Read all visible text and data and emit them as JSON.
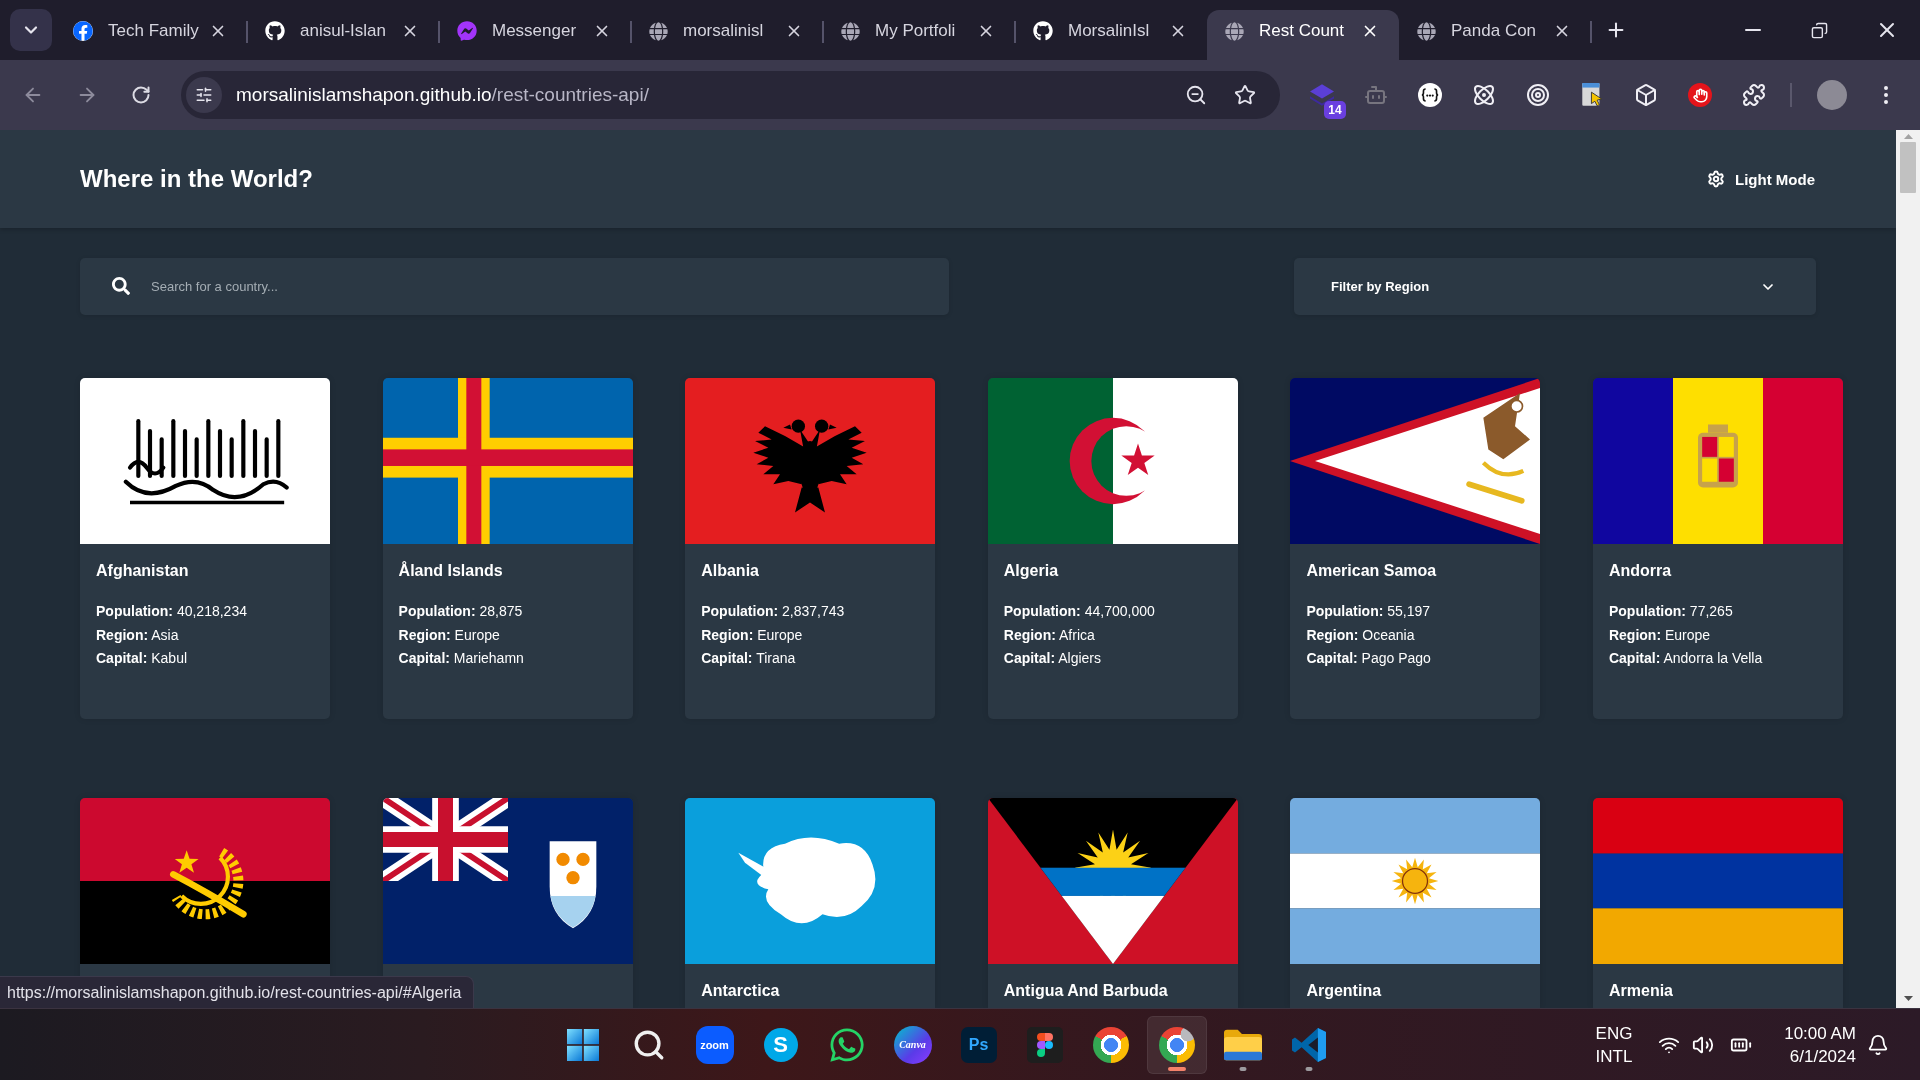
{
  "browser": {
    "tabs": [
      {
        "kind": "facebook",
        "title": "Tech Family",
        "selected": false
      },
      {
        "kind": "github",
        "title": "anisul-Islan",
        "selected": false
      },
      {
        "kind": "messenger",
        "title": "Messenger",
        "selected": false
      },
      {
        "kind": "globe",
        "title": "morsalinisl",
        "selected": false
      },
      {
        "kind": "globe",
        "title": "My Portfoli",
        "selected": false
      },
      {
        "kind": "github",
        "title": "MorsalinIsl",
        "selected": false
      },
      {
        "kind": "globe",
        "title": "Rest Count",
        "selected": true
      },
      {
        "kind": "globe",
        "title": "Panda Con",
        "selected": false
      }
    ],
    "nav": [
      {
        "kind": "back",
        "disabled": true
      },
      {
        "kind": "forward",
        "disabled": true
      },
      {
        "kind": "reload",
        "disabled": false
      }
    ],
    "address": {
      "host": "morsalinislamshapon.github.io",
      "path": "/rest-countries-api/"
    },
    "extensions": [
      {
        "kind": "layers",
        "badge": "14"
      },
      {
        "kind": "robot"
      },
      {
        "kind": "braces"
      },
      {
        "kind": "atom"
      },
      {
        "kind": "target"
      },
      {
        "kind": "pointer"
      },
      {
        "kind": "cube"
      },
      {
        "kind": "hand"
      },
      {
        "kind": "puzzle"
      }
    ],
    "status_url": "https://morsalinislamshapon.github.io/rest-countries-api/#Algeria"
  },
  "page": {
    "title": "Where in the World?",
    "theme_toggle": "Light Mode",
    "search": {
      "placeholder": "Search for a country..."
    },
    "filter": {
      "label": "Filter by Region"
    },
    "countries": [
      {
        "kind": "af",
        "name": "Afghanistan",
        "facts": [
          "**Population:** 40,218,234",
          "**Region:** Asia",
          "**Capital:** Kabul"
        ]
      },
      {
        "kind": "ax",
        "name": "Åland Islands",
        "facts": [
          "**Population:** 28,875",
          "**Region:** Europe",
          "**Capital:** Mariehamn"
        ]
      },
      {
        "kind": "al",
        "name": "Albania",
        "facts": [
          "**Population:** 2,837,743",
          "**Region:** Europe",
          "**Capital:** Tirana"
        ]
      },
      {
        "kind": "dz",
        "name": "Algeria",
        "facts": [
          "**Population:** 44,700,000",
          "**Region:** Africa",
          "**Capital:** Algiers"
        ]
      },
      {
        "kind": "as",
        "name": "American Samoa",
        "facts": [
          "**Population:** 55,197",
          "**Region:** Oceania",
          "**Capital:** Pago Pago"
        ]
      },
      {
        "kind": "ad",
        "name": "Andorra",
        "facts": [
          "**Population:** 77,265",
          "**Region:** Europe",
          "**Capital:** Andorra la Vella"
        ]
      },
      {
        "kind": "ao"
      },
      {
        "kind": "ai"
      },
      {
        "kind": "aq",
        "name": "Antarctica"
      },
      {
        "kind": "ag",
        "name": "Antigua And Barbuda"
      },
      {
        "kind": "ar",
        "name": "Argentina"
      },
      {
        "kind": "am",
        "name": "Armenia"
      }
    ]
  },
  "taskbar": {
    "apps": [
      {
        "kind": "start",
        "selected": false,
        "running": false
      },
      {
        "kind": "search",
        "selected": false,
        "running": false
      },
      {
        "kind": "zoom",
        "text": "zoom",
        "selected": false,
        "running": false
      },
      {
        "kind": "skype",
        "text": "S",
        "selected": false,
        "running": false
      },
      {
        "kind": "whatsapp",
        "selected": false,
        "running": false
      },
      {
        "kind": "canva",
        "text": "Canva",
        "selected": false,
        "running": false
      },
      {
        "kind": "photoshop",
        "text": "Ps",
        "selected": false,
        "running": false
      },
      {
        "kind": "figma",
        "selected": false,
        "running": false
      },
      {
        "kind": "chrome",
        "selected": false,
        "running": false
      },
      {
        "kind": "chromeuser",
        "selected": true,
        "running": true
      },
      {
        "kind": "files",
        "selected": false,
        "running": true
      },
      {
        "kind": "vscode",
        "selected": false,
        "running": true
      }
    ],
    "language": "ENG",
    "layout": "INTL",
    "time": "10:00 AM",
    "date": "6/1/2024"
  }
}
